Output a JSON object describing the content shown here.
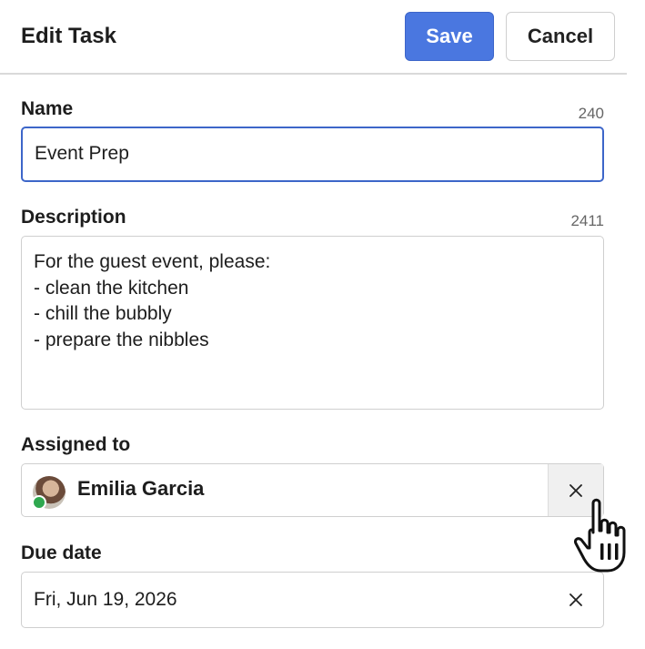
{
  "header": {
    "title": "Edit Task",
    "save_label": "Save",
    "cancel_label": "Cancel",
    "accent_color": "#4a77e0"
  },
  "name_field": {
    "label": "Name",
    "counter": "240",
    "value": "Event Prep"
  },
  "description_field": {
    "label": "Description",
    "counter": "2411",
    "value": "For the guest event, please:\n- clean the kitchen\n- chill the bubbly\n- prepare the nibbles"
  },
  "assigned_field": {
    "label": "Assigned to",
    "assignee_name": "Emilia Garcia",
    "presence_color": "#2fa84f",
    "clear_icon": "close-icon"
  },
  "due_date_field": {
    "label": "Due date",
    "value": "Fri, Jun 19, 2026",
    "clear_icon": "close-icon"
  },
  "cursor": {
    "type": "hand-pointer-icon"
  }
}
